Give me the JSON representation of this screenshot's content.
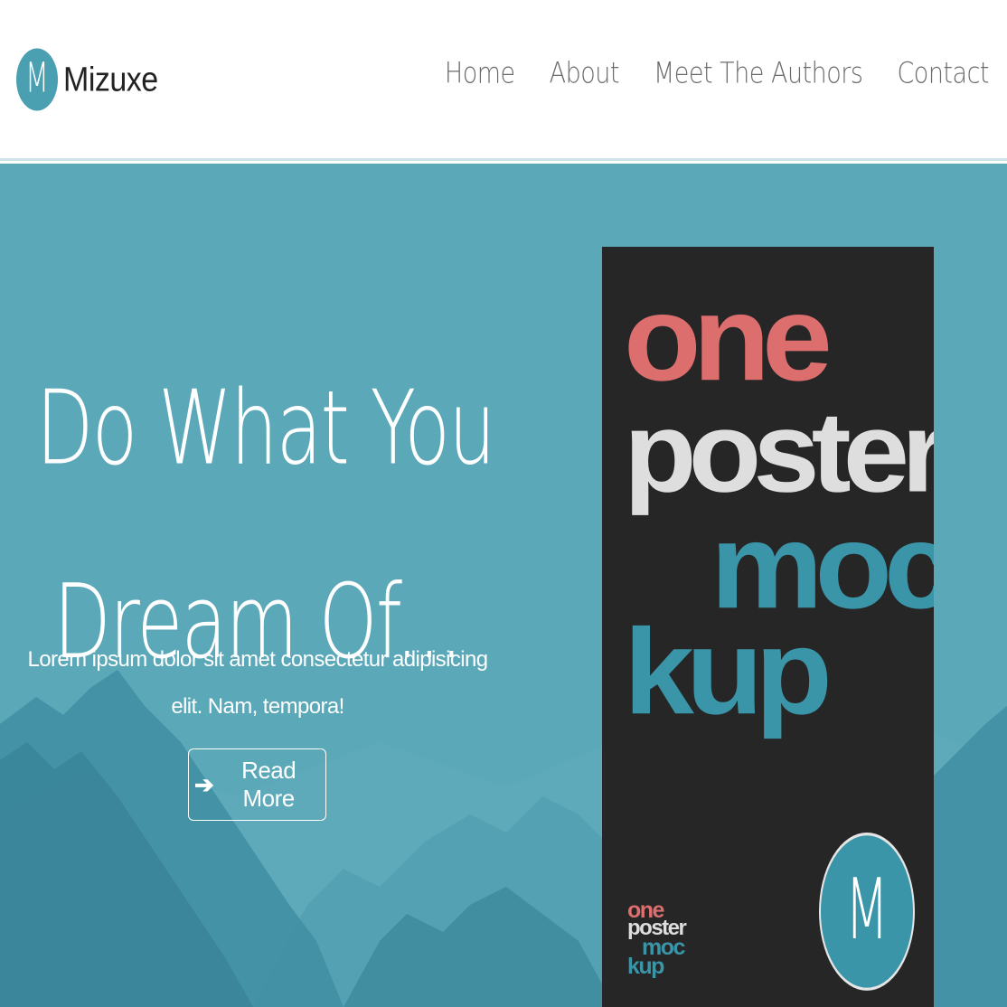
{
  "brand": {
    "logo_letter": "M",
    "name": "Mizuxe"
  },
  "nav": {
    "links": [
      "Home",
      "About",
      "Meet The Authors",
      "Contact"
    ]
  },
  "hero": {
    "title_line1": "Do What You",
    "title_line2": "Dream Of...",
    "subtitle": "Lorem ipsum dolor sit amet consectetur adipisicing elit. Nam, tempora!",
    "button_label": "Read More",
    "button_icon": "arrow-right-icon",
    "background_color": "#5aa8b8"
  },
  "poster": {
    "words": [
      "one",
      "poster",
      "moc",
      "kup"
    ],
    "badge_letter": "M",
    "colors": {
      "background": "#262626",
      "one": "#dc6e6e",
      "poster": "#dedede",
      "mockup": "#3a95a8"
    }
  },
  "colors": {
    "accent": "#4a9fb1",
    "nav_text": "#6b6b6b"
  }
}
